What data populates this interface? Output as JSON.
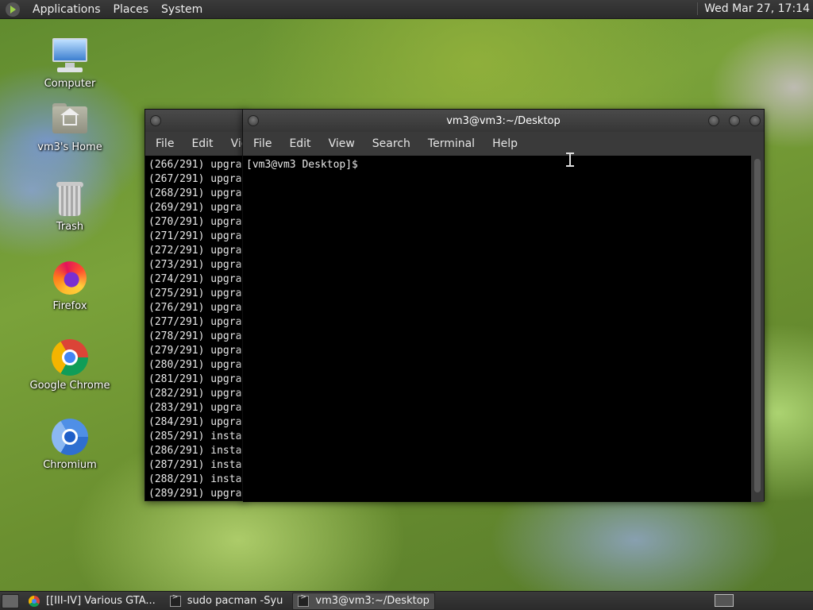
{
  "top_panel": {
    "menus": [
      "Applications",
      "Places",
      "System"
    ],
    "clock": "Wed Mar 27, 17:14"
  },
  "desktop_icons": [
    {
      "label": "Computer",
      "icon": "computer-icon"
    },
    {
      "label": "vm3's Home",
      "icon": "home-folder-icon"
    },
    {
      "label": "Trash",
      "icon": "trash-icon"
    },
    {
      "label": "Firefox",
      "icon": "firefox-icon"
    },
    {
      "label": "Google Chrome",
      "icon": "google-chrome-icon"
    },
    {
      "label": "Chromium",
      "icon": "chromium-icon"
    }
  ],
  "back_terminal": {
    "menus": [
      "File",
      "Edit",
      "View"
    ],
    "lines": [
      "(266/291) upgra",
      "(267/291) upgra",
      "(268/291) upgra",
      "(269/291) upgra",
      "(270/291) upgra",
      "(271/291) upgra",
      "(272/291) upgra",
      "(273/291) upgra",
      "(274/291) upgra",
      "(275/291) upgra",
      "(276/291) upgra",
      "(277/291) upgra",
      "(278/291) upgra",
      "(279/291) upgra",
      "(280/291) upgra",
      "(281/291) upgra",
      "(282/291) upgra",
      "(283/291) upgra",
      "(284/291) upgra",
      "(285/291) insta",
      "(286/291) insta",
      "(287/291) insta",
      "(288/291) insta",
      "(289/291) upgra"
    ]
  },
  "front_terminal": {
    "title": "vm3@vm3:~/Desktop",
    "menus": [
      "File",
      "Edit",
      "View",
      "Search",
      "Terminal",
      "Help"
    ],
    "prompt": "[vm3@vm3 Desktop]$"
  },
  "taskbar": {
    "tasks": [
      {
        "label": "[[III-IV] Various GTA...",
        "icon": "chrome-icon",
        "active": false
      },
      {
        "label": "sudo pacman -Syu",
        "icon": "terminal-icon",
        "active": false
      },
      {
        "label": "vm3@vm3:~/Desktop",
        "icon": "terminal-icon",
        "active": true
      }
    ]
  }
}
